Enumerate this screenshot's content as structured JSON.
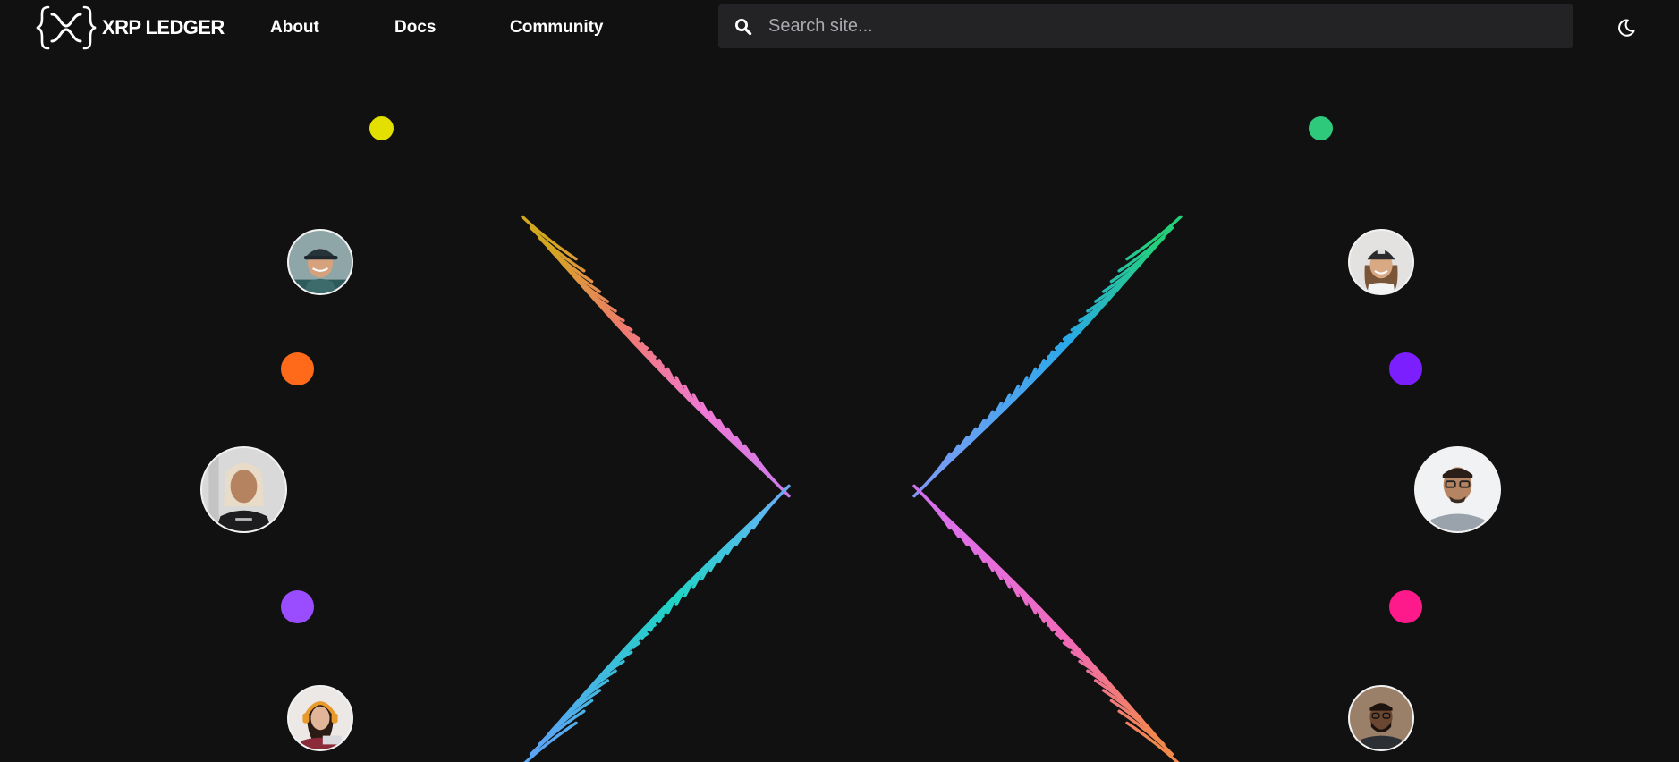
{
  "brand": {
    "name": "XRP LEDGER",
    "logo_icon": "xrp-logo-icon"
  },
  "nav": {
    "items": [
      {
        "label": "About"
      },
      {
        "label": "Docs"
      },
      {
        "label": "Community"
      }
    ]
  },
  "search": {
    "placeholder": "Search site...",
    "value": "",
    "icon": "search-icon"
  },
  "theme_toggle": {
    "icon": "moon-icon"
  },
  "colors": {
    "background": "#111112",
    "search_bg": "#232325",
    "dot_yellow": "#e3e000",
    "dot_green": "#2ec97a",
    "dot_orange": "#ff6a1a",
    "dot_violet": "#7b1fff",
    "dot_purple": "#9a4dff",
    "dot_magenta": "#ff1a8c"
  },
  "hero": {
    "avatars": [
      {
        "icon": "person-avatar-cap"
      },
      {
        "icon": "person-avatar-beanie"
      },
      {
        "icon": "person-avatar-blonde"
      },
      {
        "icon": "person-avatar-glasses"
      },
      {
        "icon": "person-avatar-headphones"
      },
      {
        "icon": "person-avatar-beard"
      }
    ]
  }
}
